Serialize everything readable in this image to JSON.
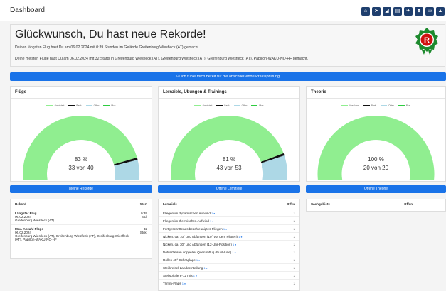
{
  "app": {
    "title": "Dashboard"
  },
  "topbar_icons": [
    "home-icon",
    "send-icon",
    "chart-icon",
    "book-icon",
    "plane-icon",
    "users-icon",
    "card-icon",
    "warning-icon"
  ],
  "hero": {
    "headline": "Glückwunsch, Du hast neue Rekorde!",
    "line1": "Deinen längsten Flug hast Du am 06.02.2024 mit 0:39 Stunden im Gelände Greifenburg Wiesfleck (AT) gemacht.",
    "line2": "Deine meisten Flüge hast Du am 06.02.2024 mit 32 Starts in Greifenburg Wiesfleck (AT), Greifenburg Wiesfleck (AT), Greifenburg Wiesfleck (AT), Papillon-WAKU-NO-HF gemacht.",
    "badge_letter": "R"
  },
  "ready_button": "☑ Ich fühle mich bereit für die abschließende Praxisprüfung",
  "legend": [
    "Absolviert",
    "Bank",
    "Offen",
    "Plus"
  ],
  "colors": {
    "absolviert": "#90ee90",
    "bank": "#111111",
    "offen": "#add8e6",
    "plus": "#2ecc40",
    "primary": "#1a73e8"
  },
  "cards": [
    {
      "title": "Flüge",
      "pct": "83 %",
      "count": "33 von 40",
      "fraction": 0.83,
      "button": "Meine Rekorde"
    },
    {
      "title": "Lernziele, Übungen & Trainings",
      "pct": "81 %",
      "count": "43 von 53",
      "fraction": 0.81,
      "button": "Offene Lernziele"
    },
    {
      "title": "Theorie",
      "pct": "100 %",
      "count": "20 von 20",
      "fraction": 1.0,
      "button": "Offene Theorie"
    }
  ],
  "records": {
    "headers": [
      "Rekord",
      "Wert"
    ],
    "rows": [
      {
        "name": "Längster Flug",
        "date": "06.02.2024",
        "place": "Greifenburg Wiesfleck (AT)",
        "value": "0:39",
        "unit": "Std."
      },
      {
        "name": "Max. Anzahl Flüge",
        "date": "06.02.2024",
        "place": "Greifenburg Wiesfleck (AT), Greifenburg Wiesfleck (AT), Greifenburg Wiesfleck (AT), Papillon-WAKU-NO-HF",
        "value": "32",
        "unit": "Stck."
      }
    ]
  },
  "lernziele": {
    "headers": [
      "Lernziele",
      "Offen"
    ],
    "rows": [
      {
        "name": "Fliegen im dynamischen Aufwind",
        "tag": "1 ●",
        "open": "1"
      },
      {
        "name": "Fliegen im thermischen Aufwind",
        "tag": "1 ●",
        "open": "1"
      },
      {
        "name": "Fortgeschrittenes beschleunigtes Fliegen",
        "tag": "1 ●",
        "open": "1"
      },
      {
        "name": "Nicken, ca. 10° und Abfangen (10° vor dem Piloten)",
        "tag": "1 ●",
        "open": "1"
      },
      {
        "name": "Nicken, ca. 30° und Abfangen (12-Uhr-Position)",
        "tag": "1 ●",
        "open": "1"
      },
      {
        "name": "Notverfahren doppelter Querumflug (Bunt-Line)",
        "tag": "1 ●",
        "open": "1"
      },
      {
        "name": "Rollen 45° Schräglage",
        "tag": "1 ●",
        "open": "1"
      },
      {
        "name": "Steilkreisel-Landeeinteilung",
        "tag": "1 ●",
        "open": "1"
      },
      {
        "name": "Steilspirale 8-12 m/s",
        "tag": "1 ●",
        "open": "1"
      },
      {
        "name": "Trimm-Flaps",
        "tag": "1 ●",
        "open": "1"
      }
    ]
  },
  "theorie": {
    "headers": [
      "Sachgebiete",
      "Offen"
    ]
  }
}
